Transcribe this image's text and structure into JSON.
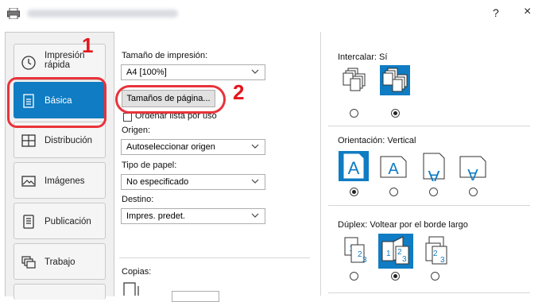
{
  "window": {
    "title_blurred": "Propiedades: Kyocera TASKalfa 7054ci KX",
    "help_label": "?",
    "close_label": "×"
  },
  "sidebar": {
    "items": [
      {
        "label": "Impresión rápida",
        "icon": "clock-icon"
      },
      {
        "label": "Básica",
        "icon": "document-icon",
        "active": true
      },
      {
        "label": "Distribución",
        "icon": "layout-icon"
      },
      {
        "label": "Imágenes",
        "icon": "image-icon"
      },
      {
        "label": "Publicación",
        "icon": "publication-icon"
      },
      {
        "label": "Trabajo",
        "icon": "job-icon"
      }
    ]
  },
  "basic": {
    "print_size_label": "Tamaño de impresión:",
    "print_size_value": "A4 [100%]",
    "page_sizes_button": "Tamaños de página...",
    "sort_checkbox_label": "Ordenar lista por uso",
    "source_label": "Origen:",
    "source_value": "Autoseleccionar origen",
    "paper_type_label": "Tipo de papel:",
    "paper_type_value": "No especificado",
    "destination_label": "Destino:",
    "destination_value": "Impres. predet.",
    "copies_label": "Copias:"
  },
  "collate": {
    "label": "Intercalar:",
    "value": "Sí",
    "selected_index": 1
  },
  "orientation": {
    "label": "Orientación:",
    "value": "Vertical",
    "selected_index": 0,
    "glyph": "A"
  },
  "duplex": {
    "label": "Dúplex:",
    "value": "Voltear por el borde largo",
    "selected_index": 1
  },
  "callouts": {
    "one": "1",
    "two": "2"
  },
  "colors": {
    "accent": "#0f7cc3",
    "callout_red": "#e3161d"
  }
}
